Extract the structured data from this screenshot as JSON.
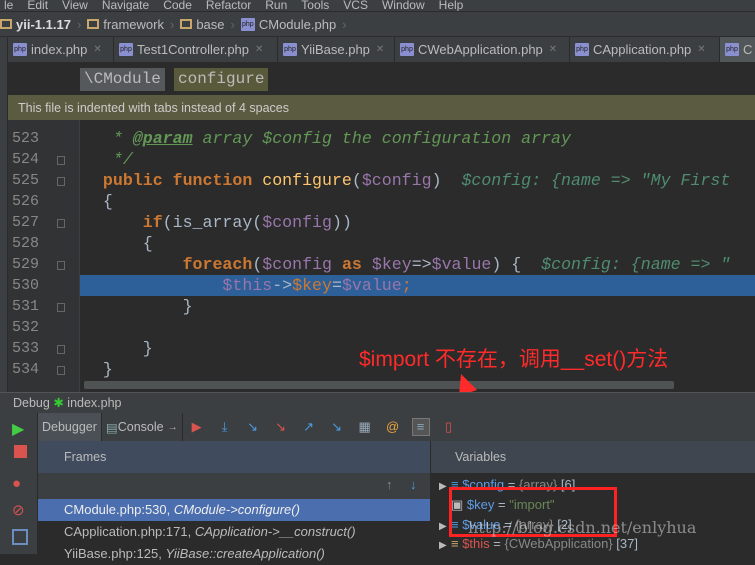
{
  "menu": [
    "le",
    "Edit",
    "View",
    "Navigate",
    "Code",
    "Refactor",
    "Run",
    "Tools",
    "VCS",
    "Window",
    "Help"
  ],
  "breadcrumb": {
    "project": "yii-1.1.17",
    "items": [
      "framework",
      "base"
    ],
    "file": "CModule.php"
  },
  "tabs": [
    {
      "label": "index.php"
    },
    {
      "label": "Test1Controller.php"
    },
    {
      "label": "YiiBase.php"
    },
    {
      "label": "CWebApplication.php"
    },
    {
      "label": "CApplication.php"
    },
    {
      "label": "C"
    }
  ],
  "nav": {
    "class": "\\CModule",
    "method": "configure"
  },
  "notice": "This file is indented with tabs instead of 4 spaces",
  "editor": {
    "line_numbers": [
      "523",
      "524",
      "525",
      "526",
      "527",
      "528",
      "529",
      "530",
      "531",
      "532",
      "533",
      "534"
    ],
    "current_line": "530"
  },
  "annotation": "$import 不存在，调用__set()方法",
  "debug": {
    "title": "Debug",
    "config": "index.php",
    "tabs": {
      "debugger": "Debugger",
      "console": "Console"
    },
    "frames_title": "Frames",
    "variables_title": "Variables",
    "frames": [
      {
        "loc": "CModule.php:530, ",
        "fn": "CModule->configure()"
      },
      {
        "loc": "CApplication.php:171, ",
        "fn": "CApplication->__construct()"
      },
      {
        "loc": "YiiBase.php:125, ",
        "fn": "YiiBase::createApplication()"
      }
    ],
    "variables": [
      {
        "name": "$config",
        "eq": " = ",
        "type": "{array}",
        "extra": " [6]"
      },
      {
        "name": "$key",
        "eq": " = ",
        "value": "\"import\""
      },
      {
        "name": "$value",
        "eq": " = ",
        "type": "{array}",
        "extra": " [2]"
      },
      {
        "name": "$this",
        "eq": " = ",
        "type": "{CWebApplication}",
        "extra": " [37]"
      }
    ]
  },
  "watermark": "http://blog.csdn.net/enlyhua",
  "colors": {
    "highlight": "#2d5f99",
    "selected_frame": "#4b6eaf",
    "annotation": "#ff2a2a",
    "notice_bg": "#5b5b41"
  }
}
